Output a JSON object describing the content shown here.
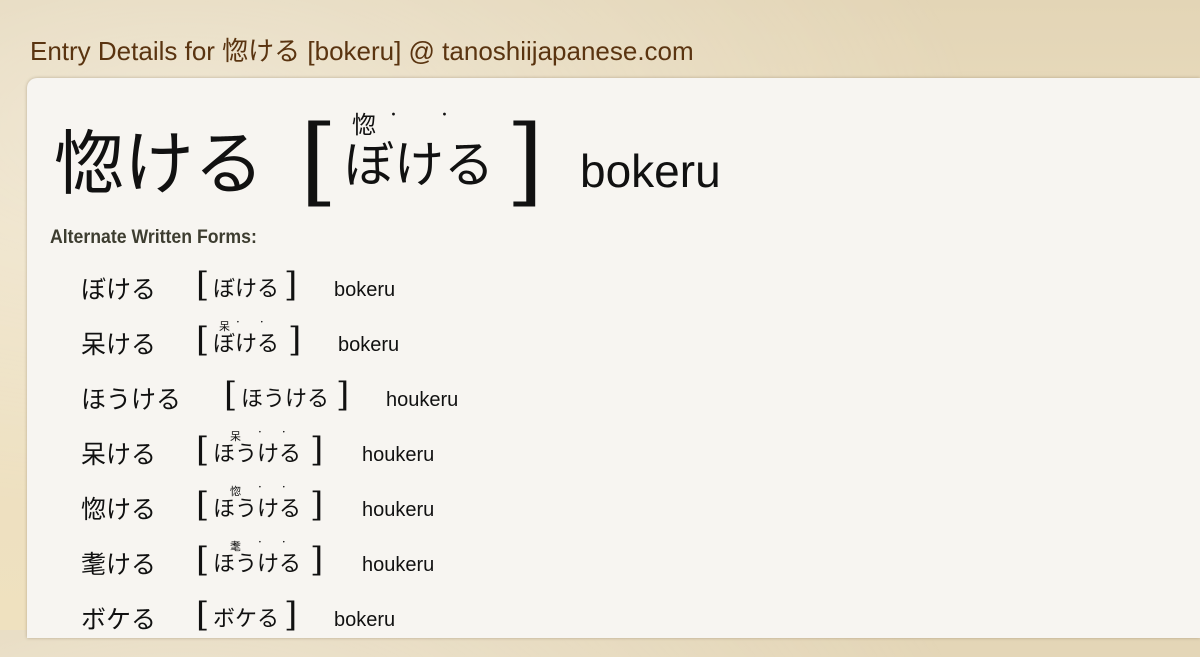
{
  "header": {
    "title": "Entry Details for 惚ける [bokeru] @ tanoshiijapanese.com"
  },
  "entry": {
    "word": "惚ける",
    "furigana": "惚",
    "reading": "ぼける",
    "romaji": "bokeru"
  },
  "alternates": {
    "heading": "Alternate Written Forms:",
    "items": [
      {
        "word": "ぼける",
        "furigana": "",
        "reading": "ぼける",
        "romaji": "bokeru"
      },
      {
        "word": "呆ける",
        "furigana": "呆",
        "reading": "ぼける",
        "romaji": "bokeru"
      },
      {
        "word": "ほうける",
        "furigana": "",
        "reading": "ほうける",
        "romaji": "houkeru"
      },
      {
        "word": "呆ける",
        "furigana": "呆",
        "reading": "ほうける",
        "romaji": "houkeru"
      },
      {
        "word": "惚ける",
        "furigana": "惚",
        "reading": "ほうける",
        "romaji": "houkeru"
      },
      {
        "word": "耄ける",
        "furigana": "耄",
        "reading": "ほうける",
        "romaji": "houkeru"
      },
      {
        "word": "ボケる",
        "furigana": "",
        "reading": "ボケる",
        "romaji": "bokeru"
      }
    ]
  },
  "colors": {
    "header_text": "#5a3410",
    "card_background": "#f7f5f1",
    "page_background": "#e8dcc0"
  }
}
